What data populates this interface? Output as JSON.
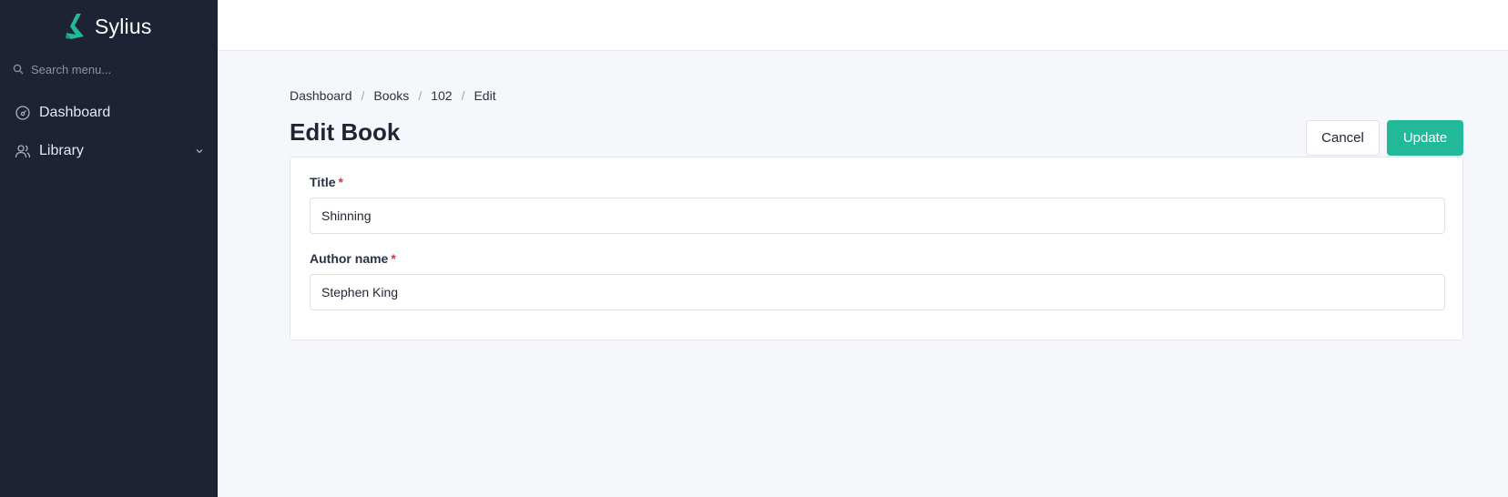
{
  "brand": {
    "name": "Sylius",
    "accent": "#22b99a"
  },
  "sidebar": {
    "search": {
      "placeholder": "Search menu..."
    },
    "items": [
      {
        "label": "Dashboard",
        "icon": "dashboard-gauge-icon"
      },
      {
        "label": "Library",
        "icon": "users-icon",
        "expandable": true
      }
    ]
  },
  "breadcrumb": [
    "Dashboard",
    "Books",
    "102",
    "Edit"
  ],
  "page": {
    "title": "Edit Book"
  },
  "actions": {
    "cancel_label": "Cancel",
    "update_label": "Update"
  },
  "form": {
    "title": {
      "label": "Title",
      "required_mark": "*",
      "value": "Shinning"
    },
    "author_name": {
      "label": "Author name",
      "required_mark": "*",
      "value": "Stephen King"
    }
  }
}
